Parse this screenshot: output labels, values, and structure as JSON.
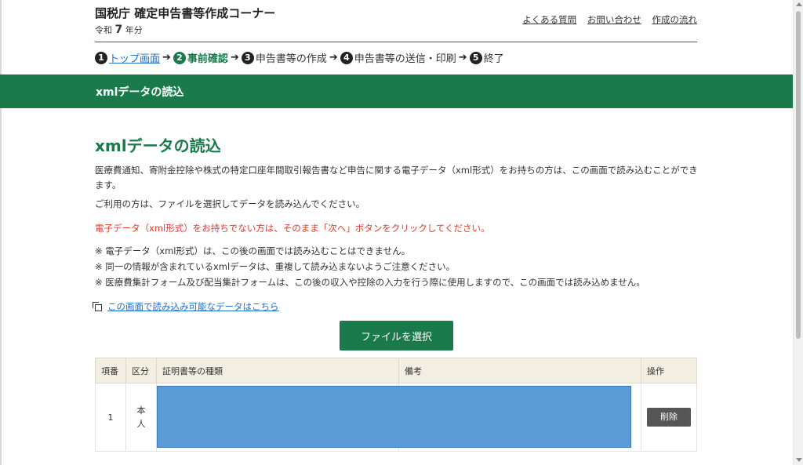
{
  "header": {
    "site_title": "国税庁 確定申告書等作成コーナー",
    "era_prefix": "令和",
    "era_year": "7",
    "era_suffix": "年分",
    "links": [
      "よくある質問",
      "お問い合わせ",
      "作成の流れ"
    ]
  },
  "steps": [
    {
      "num": "1",
      "label": "トップ画面",
      "state": "link"
    },
    {
      "num": "2",
      "label": "事前確認",
      "state": "current"
    },
    {
      "num": "3",
      "label": "申告書等の作成",
      "state": "pending"
    },
    {
      "num": "4",
      "label": "申告書等の送信・印刷",
      "state": "pending"
    },
    {
      "num": "5",
      "label": "終了",
      "state": "pending"
    }
  ],
  "band_title": "xmlデータの読込",
  "main": {
    "heading": "xmlデータの読込",
    "paragraph1": "医療費通知、寄附金控除や株式の特定口座年間取引報告書など申告に関する電子データ（xml形式）をお持ちの方は、この画面で読み込むことができます。",
    "paragraph2": "ご利用の方は、ファイルを選択してデータを読み込んでください。",
    "warning": "電子データ（xml形式）をお持ちでない方は、そのまま「次へ」ボタンをクリックしてください。",
    "notes": [
      "※ 電子データ（xml形式）は、この後の画面では読み込むことはできません。",
      "※ 同一の情報が含まれているxmlデータは、重複して読み込まないようご注意ください。",
      "※ 医療費集計フォーム及び配当集計フォームは、この後の収入や控除の入力を行う際に使用しますので、この画面では読み込めません。"
    ],
    "data_link": "この画面で読み込み可能なデータはこちら",
    "file_button": "ファイルを選択"
  },
  "table": {
    "headers": [
      "項番",
      "区分",
      "証明書等の種類",
      "備考",
      "操作"
    ],
    "rows": [
      {
        "num": "1",
        "kubun": "本人",
        "delete_label": "削除"
      }
    ]
  },
  "colors": {
    "brand_green": "#1a7a4c",
    "warning_red": "#e23b2a",
    "link_blue": "#1f6fc5",
    "redaction_blue": "#5b9bd5"
  }
}
